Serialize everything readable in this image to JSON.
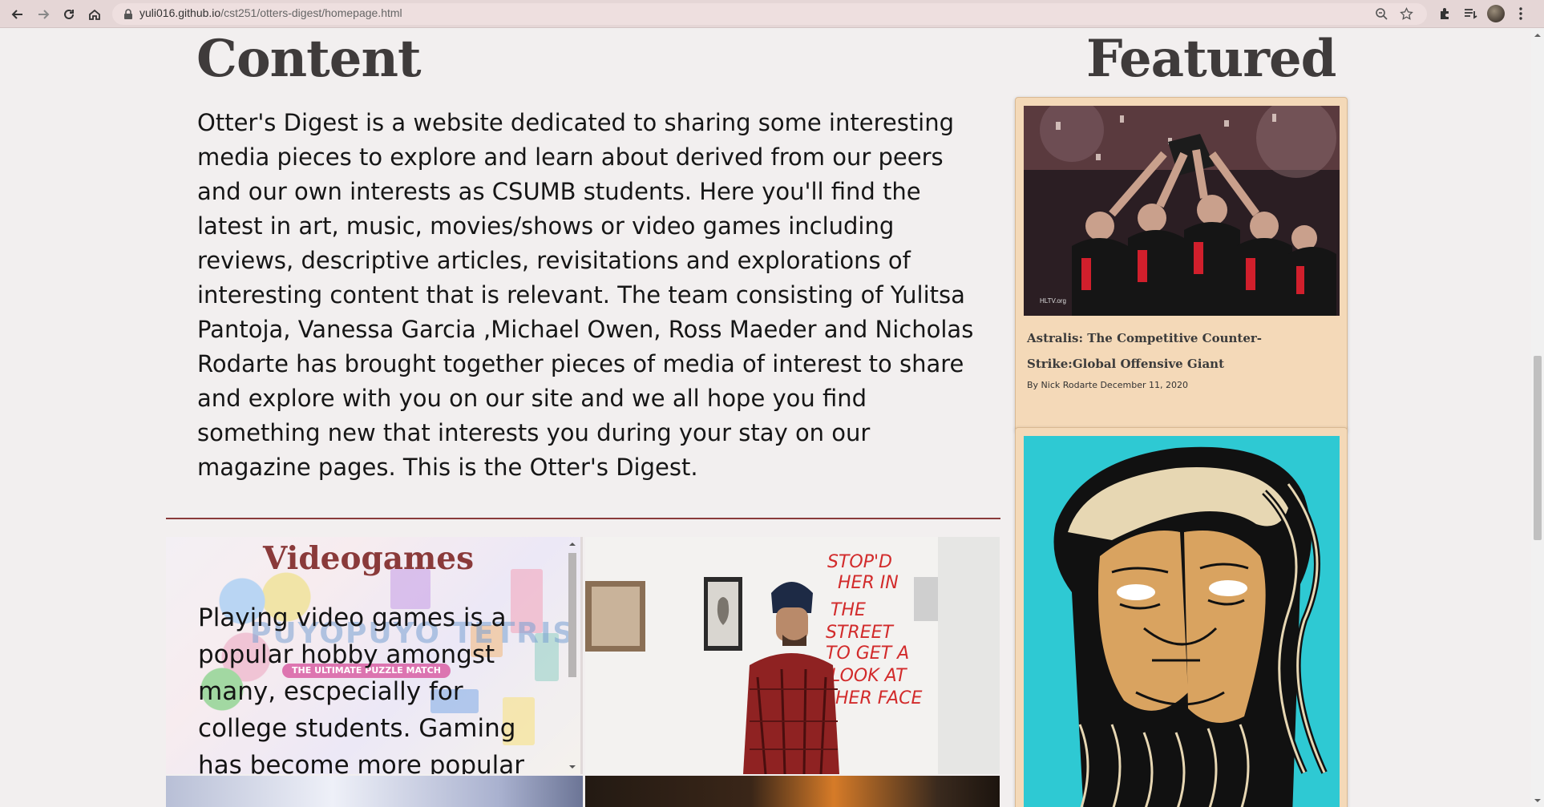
{
  "browser": {
    "url_host": "yuli016.github.io",
    "url_path": "/cst251/otters-digest/homepage.html"
  },
  "content": {
    "heading": "Content",
    "intro": "Otter's Digest is a website dedicated to sharing some interesting media pieces to explore and learn about derived from our peers and our own interests as CSUMB students. Here you'll find the latest in art, music, movies/shows or video games including reviews, descriptive articles, revisitations and explorations of interesting content that is relevant. The team consisting of Yulitsa Pantoja, Vanessa Garcia ,Michael Owen, Ross Maeder and Nicholas Rodarte has brought together pieces of media of interest to share and explore with you on our site and we all hope you find something new that interests you during your stay on our magazine pages. This is the Otter's Digest."
  },
  "videogames": {
    "title": "Videogames",
    "text": "Playing video games is a popular hobby amongst many, escpecially for college students. Gaming has become more popular",
    "bg_watermark": "PUYOPUYO TETRIS",
    "bg_subtitle": "THE ULTIMATE PUZZLE MATCH"
  },
  "art_tile": {
    "wall_text": "STOP'D HER IN THE STREET TO GET A LOOK AT HER FACE"
  },
  "featured": {
    "heading": "Featured",
    "card1": {
      "title": "Astralis: The Competitive Counter-Strike:Global Offensive Giant",
      "meta": "By Nick Rodarte December 11, 2020",
      "image_watermark": "HLTV.org"
    }
  },
  "colors": {
    "accent": "#8a3a3a",
    "card_bg": "#f4d9b8",
    "page_bg": "#f2efef",
    "chrome_bg": "#e5d6d6"
  }
}
